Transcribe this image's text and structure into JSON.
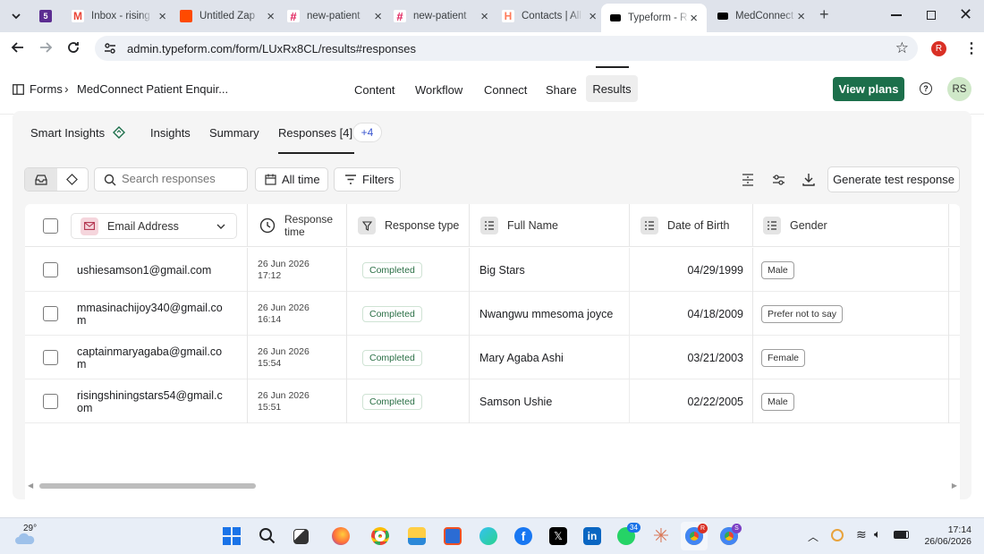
{
  "browser": {
    "tabs": [
      {
        "label": "",
        "fav_color": "#5c2d91",
        "fav_text": "5"
      },
      {
        "label": "Inbox - rising",
        "fav_color": "#ea4335",
        "fav_text": "M"
      },
      {
        "label": "Untitled Zap",
        "fav_color": "#ff4a00",
        "fav_text": ""
      },
      {
        "label": "new-patient",
        "fav_color": "#4a154b",
        "fav_text": "#"
      },
      {
        "label": "new-patient",
        "fav_color": "#4a154b",
        "fav_text": "#"
      },
      {
        "label": "Contacts | All",
        "fav_color": "#ff7a59",
        "fav_text": "H"
      },
      {
        "label": "Typeform - R",
        "fav_color": "#000000",
        "fav_text": ""
      },
      {
        "label": "MedConnect",
        "fav_color": "#000000",
        "fav_text": ""
      }
    ],
    "url": "admin.typeform.com/form/LUxRx8CL/results#responses",
    "profile_initial": "R"
  },
  "nav": {
    "forms_label": "Forms",
    "separator": "›",
    "form_title": "MedConnect Patient Enquir...",
    "tabs": [
      "Content",
      "Workflow",
      "Connect",
      "Share",
      "Results"
    ],
    "view_plans": "View plans",
    "help": "?",
    "avatar": "RS"
  },
  "subtabs": {
    "smart": "Smart Insights",
    "insights": "Insights",
    "summary": "Summary",
    "responses": "Responses [4]",
    "more": "+4"
  },
  "toolbar": {
    "search_placeholder": "Search responses",
    "all_time": "All time",
    "filters": "Filters",
    "generate": "Generate test response"
  },
  "table": {
    "headers": {
      "email": "Email Address",
      "time_line1": "Response",
      "time_line2": "time",
      "type": "Response type",
      "name": "Full Name",
      "dob": "Date of Birth",
      "gender": "Gender"
    },
    "rows": [
      {
        "email1": "ushiesamson1@gmail.com",
        "email2": "",
        "date": "26 Jun 2026",
        "time": "17:12",
        "type": "Completed",
        "name": "Big Stars",
        "dob": "04/29/1999",
        "gender": "Male"
      },
      {
        "email1": "mmasinachijoy340@gmail.co",
        "email2": "m",
        "date": "26 Jun 2026",
        "time": "16:14",
        "type": "Completed",
        "name": "Nwangwu mmesoma joyce",
        "dob": "04/18/2009",
        "gender": "Prefer not to say"
      },
      {
        "email1": "captainmaryagaba@gmail.co",
        "email2": "m",
        "date": "26 Jun 2026",
        "time": "15:54",
        "type": "Completed",
        "name": "Mary Agaba Ashi",
        "dob": "03/21/2003",
        "gender": "Female"
      },
      {
        "email1": "risingshiningstars54@gmail.c",
        "email2": "om",
        "date": "26 Jun 2026",
        "time": "15:51",
        "type": "Completed",
        "name": "Samson Ushie",
        "dob": "02/22/2005",
        "gender": "Male"
      }
    ]
  },
  "taskbar": {
    "weather": "29°",
    "time": "17:14",
    "date": "26/06/2026",
    "badge_whatsapp": "34",
    "badge_chrome": "R",
    "badge_chrome2": "S"
  }
}
